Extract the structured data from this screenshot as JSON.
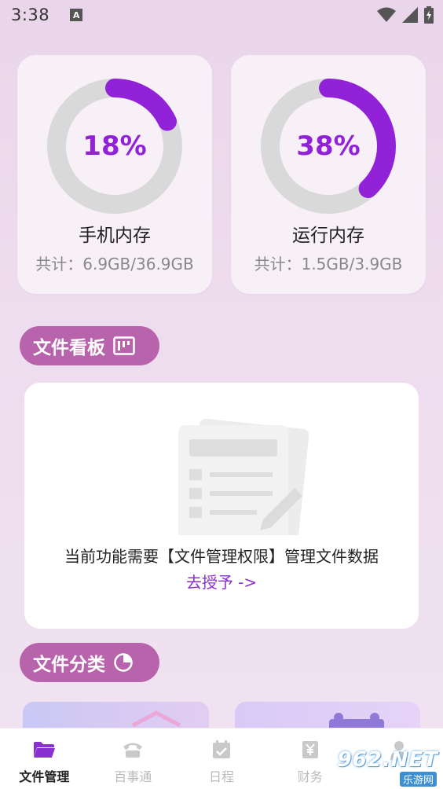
{
  "status_bar": {
    "time": "3:38",
    "badge": "A"
  },
  "memory": {
    "phone": {
      "percent": "18%",
      "value": 0.18,
      "title": "手机内存",
      "total": "共计：6.9GB/36.9GB"
    },
    "ram": {
      "percent": "38%",
      "value": 0.38,
      "title": "运行内存",
      "total": "共计：1.5GB/3.9GB"
    },
    "ring_color": "#9122d8",
    "track_color": "#d9d9d9"
  },
  "board": {
    "title": "文件看板",
    "message": "当前功能需要【文件管理权限】管理文件数据",
    "link": "去授予 ->"
  },
  "category": {
    "title": "文件分类"
  },
  "bottom_nav": {
    "items": [
      {
        "label": "文件管理",
        "icon": "folder-icon"
      },
      {
        "label": "百事通",
        "icon": "phone-icon"
      },
      {
        "label": "日程",
        "icon": "calendar-check-icon"
      },
      {
        "label": "财务",
        "icon": "yuan-icon"
      },
      {
        "label": "",
        "icon": "user-icon"
      }
    ]
  },
  "watermark": {
    "text": "962.NET",
    "sub": "乐游网"
  },
  "colors": {
    "accent": "#9122d8",
    "pill": "#b864ad"
  }
}
